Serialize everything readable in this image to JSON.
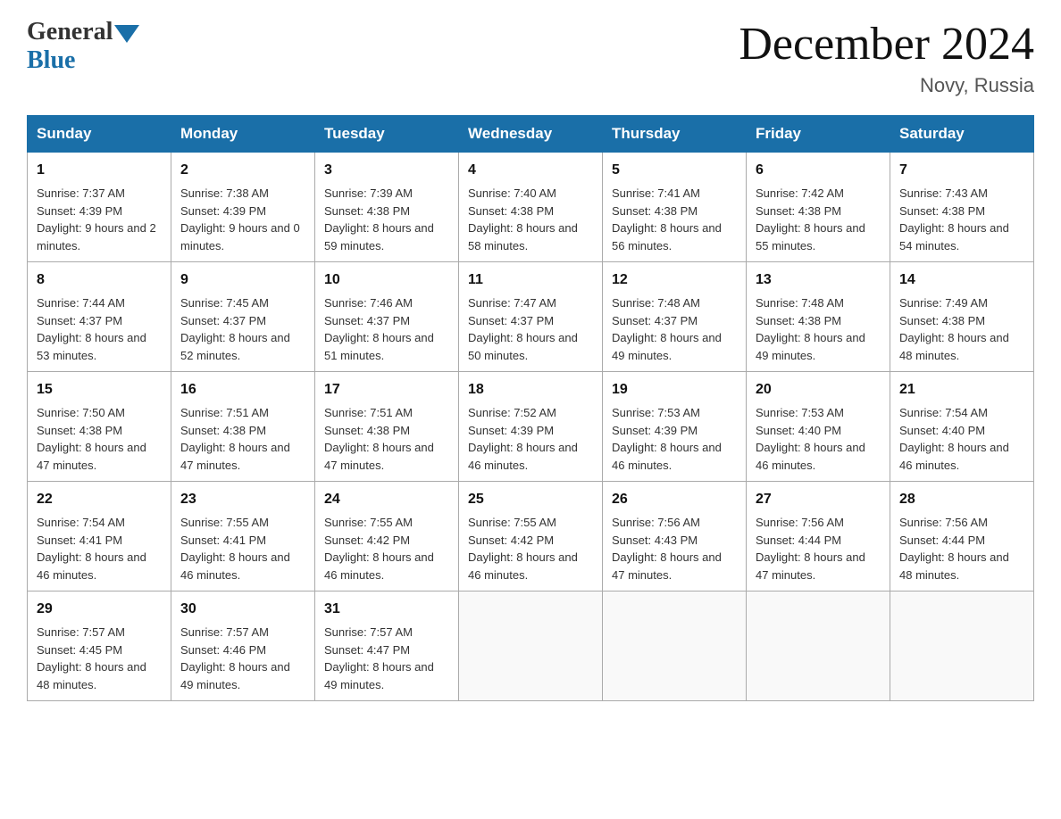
{
  "logo": {
    "general": "General",
    "blue": "Blue"
  },
  "title": {
    "month_year": "December 2024",
    "location": "Novy, Russia"
  },
  "days_of_week": [
    "Sunday",
    "Monday",
    "Tuesday",
    "Wednesday",
    "Thursday",
    "Friday",
    "Saturday"
  ],
  "weeks": [
    [
      {
        "day": "1",
        "sunrise": "7:37 AM",
        "sunset": "4:39 PM",
        "daylight": "9 hours and 2 minutes."
      },
      {
        "day": "2",
        "sunrise": "7:38 AM",
        "sunset": "4:39 PM",
        "daylight": "9 hours and 0 minutes."
      },
      {
        "day": "3",
        "sunrise": "7:39 AM",
        "sunset": "4:38 PM",
        "daylight": "8 hours and 59 minutes."
      },
      {
        "day": "4",
        "sunrise": "7:40 AM",
        "sunset": "4:38 PM",
        "daylight": "8 hours and 58 minutes."
      },
      {
        "day": "5",
        "sunrise": "7:41 AM",
        "sunset": "4:38 PM",
        "daylight": "8 hours and 56 minutes."
      },
      {
        "day": "6",
        "sunrise": "7:42 AM",
        "sunset": "4:38 PM",
        "daylight": "8 hours and 55 minutes."
      },
      {
        "day": "7",
        "sunrise": "7:43 AM",
        "sunset": "4:38 PM",
        "daylight": "8 hours and 54 minutes."
      }
    ],
    [
      {
        "day": "8",
        "sunrise": "7:44 AM",
        "sunset": "4:37 PM",
        "daylight": "8 hours and 53 minutes."
      },
      {
        "day": "9",
        "sunrise": "7:45 AM",
        "sunset": "4:37 PM",
        "daylight": "8 hours and 52 minutes."
      },
      {
        "day": "10",
        "sunrise": "7:46 AM",
        "sunset": "4:37 PM",
        "daylight": "8 hours and 51 minutes."
      },
      {
        "day": "11",
        "sunrise": "7:47 AM",
        "sunset": "4:37 PM",
        "daylight": "8 hours and 50 minutes."
      },
      {
        "day": "12",
        "sunrise": "7:48 AM",
        "sunset": "4:37 PM",
        "daylight": "8 hours and 49 minutes."
      },
      {
        "day": "13",
        "sunrise": "7:48 AM",
        "sunset": "4:38 PM",
        "daylight": "8 hours and 49 minutes."
      },
      {
        "day": "14",
        "sunrise": "7:49 AM",
        "sunset": "4:38 PM",
        "daylight": "8 hours and 48 minutes."
      }
    ],
    [
      {
        "day": "15",
        "sunrise": "7:50 AM",
        "sunset": "4:38 PM",
        "daylight": "8 hours and 47 minutes."
      },
      {
        "day": "16",
        "sunrise": "7:51 AM",
        "sunset": "4:38 PM",
        "daylight": "8 hours and 47 minutes."
      },
      {
        "day": "17",
        "sunrise": "7:51 AM",
        "sunset": "4:38 PM",
        "daylight": "8 hours and 47 minutes."
      },
      {
        "day": "18",
        "sunrise": "7:52 AM",
        "sunset": "4:39 PM",
        "daylight": "8 hours and 46 minutes."
      },
      {
        "day": "19",
        "sunrise": "7:53 AM",
        "sunset": "4:39 PM",
        "daylight": "8 hours and 46 minutes."
      },
      {
        "day": "20",
        "sunrise": "7:53 AM",
        "sunset": "4:40 PM",
        "daylight": "8 hours and 46 minutes."
      },
      {
        "day": "21",
        "sunrise": "7:54 AM",
        "sunset": "4:40 PM",
        "daylight": "8 hours and 46 minutes."
      }
    ],
    [
      {
        "day": "22",
        "sunrise": "7:54 AM",
        "sunset": "4:41 PM",
        "daylight": "8 hours and 46 minutes."
      },
      {
        "day": "23",
        "sunrise": "7:55 AM",
        "sunset": "4:41 PM",
        "daylight": "8 hours and 46 minutes."
      },
      {
        "day": "24",
        "sunrise": "7:55 AM",
        "sunset": "4:42 PM",
        "daylight": "8 hours and 46 minutes."
      },
      {
        "day": "25",
        "sunrise": "7:55 AM",
        "sunset": "4:42 PM",
        "daylight": "8 hours and 46 minutes."
      },
      {
        "day": "26",
        "sunrise": "7:56 AM",
        "sunset": "4:43 PM",
        "daylight": "8 hours and 47 minutes."
      },
      {
        "day": "27",
        "sunrise": "7:56 AM",
        "sunset": "4:44 PM",
        "daylight": "8 hours and 47 minutes."
      },
      {
        "day": "28",
        "sunrise": "7:56 AM",
        "sunset": "4:44 PM",
        "daylight": "8 hours and 48 minutes."
      }
    ],
    [
      {
        "day": "29",
        "sunrise": "7:57 AM",
        "sunset": "4:45 PM",
        "daylight": "8 hours and 48 minutes."
      },
      {
        "day": "30",
        "sunrise": "7:57 AM",
        "sunset": "4:46 PM",
        "daylight": "8 hours and 49 minutes."
      },
      {
        "day": "31",
        "sunrise": "7:57 AM",
        "sunset": "4:47 PM",
        "daylight": "8 hours and 49 minutes."
      },
      null,
      null,
      null,
      null
    ]
  ]
}
